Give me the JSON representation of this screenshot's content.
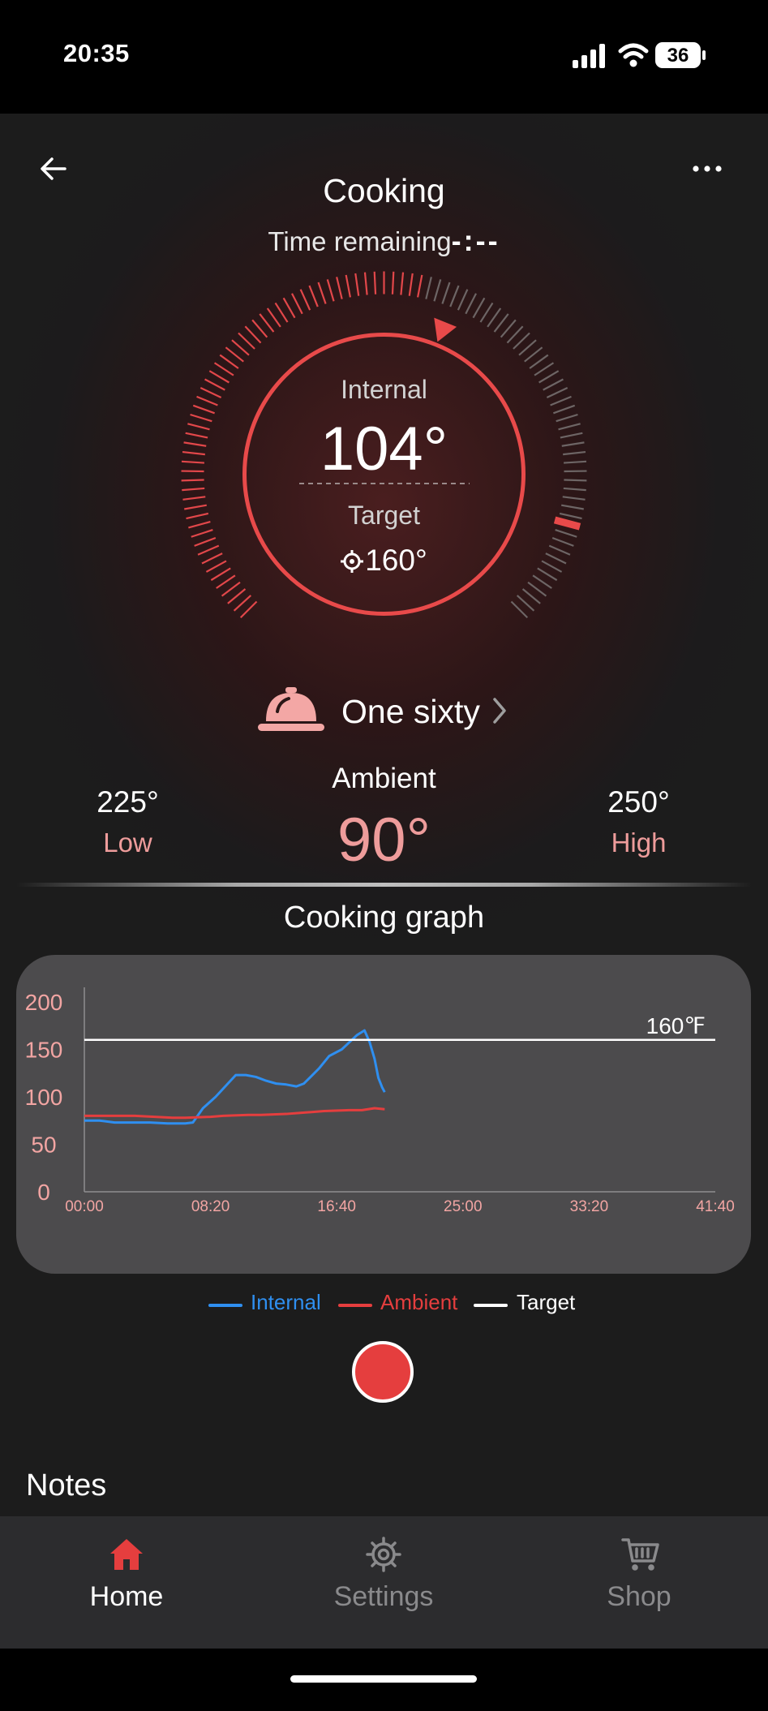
{
  "status_bar": {
    "time": "20:35",
    "battery": "36"
  },
  "header": {
    "title": "Cooking",
    "time_remaining_label": "Time remaining",
    "time_remaining_value": "-:--"
  },
  "gauge": {
    "internal_label": "Internal",
    "internal_value": "104°",
    "target_label": "Target",
    "target_value": "160°",
    "target_icon": "crosshair-icon"
  },
  "preset": {
    "icon": "cloche-icon",
    "name": "One sixty"
  },
  "ambient": {
    "label": "Ambient",
    "value": "90°",
    "low_value": "225°",
    "low_label": "Low",
    "high_value": "250°",
    "high_label": "High"
  },
  "graph": {
    "title": "Cooking graph"
  },
  "chart_data": {
    "type": "line",
    "title": "",
    "xlabel": "",
    "ylabel": "",
    "x_ticks": [
      "00:00",
      "08:20",
      "16:40",
      "25:00",
      "33:20",
      "41:40"
    ],
    "y_ticks": [
      0,
      50,
      100,
      150,
      200
    ],
    "xlim": [
      0,
      2500
    ],
    "ylim": [
      0,
      200
    ],
    "grid": false,
    "legend_position": "bottom",
    "target_line": {
      "value": 160,
      "label": "160℉"
    },
    "series": [
      {
        "name": "Internal",
        "color": "#2f8ff0",
        "x": [
          0,
          60,
          120,
          200,
          260,
          330,
          400,
          430,
          470,
          520,
          600,
          640,
          680,
          720,
          760,
          800,
          840,
          870,
          900,
          930,
          970,
          1020,
          1080,
          1110,
          1130,
          1150,
          1165,
          1180,
          1190
        ],
        "y": [
          75,
          75,
          73,
          73,
          73,
          72,
          72,
          73,
          88,
          100,
          123,
          123,
          121,
          117,
          114,
          113,
          111,
          114,
          122,
          130,
          143,
          150,
          165,
          170,
          158,
          140,
          120,
          110,
          105
        ]
      },
      {
        "name": "Ambient",
        "color": "#e53e3e",
        "x": [
          0,
          100,
          200,
          350,
          400,
          500,
          550,
          650,
          700,
          800,
          850,
          900,
          950,
          1050,
          1100,
          1150,
          1190
        ],
        "y": [
          80,
          80,
          80,
          78,
          78,
          79,
          80,
          81,
          81,
          82,
          83,
          84,
          85,
          86,
          86,
          88,
          87
        ]
      },
      {
        "name": "Target",
        "color": "#ffffff",
        "x": [
          0,
          2500
        ],
        "y": [
          160,
          160
        ]
      }
    ]
  },
  "controls": {
    "record_button": "record-button"
  },
  "notes": {
    "title": "Notes"
  },
  "nav": {
    "items": [
      {
        "label": "Home",
        "icon": "home-icon",
        "active": true
      },
      {
        "label": "Settings",
        "icon": "gear-icon",
        "active": false
      },
      {
        "label": "Shop",
        "icon": "cart-icon",
        "active": false
      }
    ]
  },
  "colors": {
    "accent": "#e53e3e",
    "accent_soft": "#ee9c9b",
    "internal": "#2f8ff0",
    "nav_inactive": "#8a8a8c"
  }
}
